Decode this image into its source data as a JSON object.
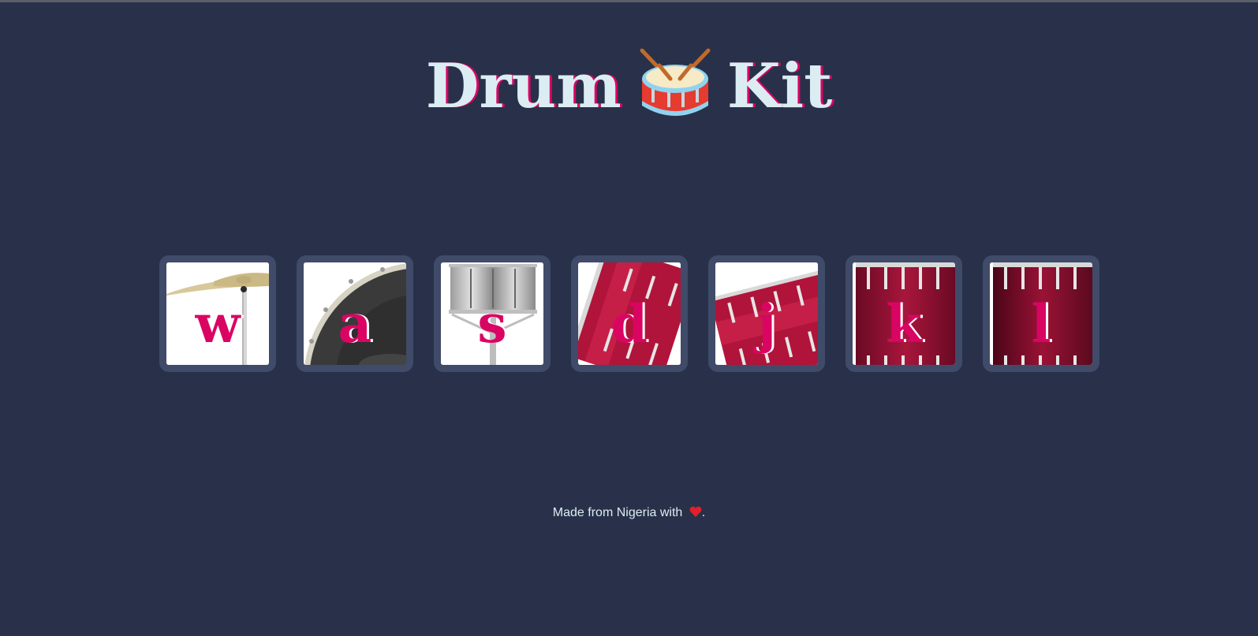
{
  "app": {
    "title_left": "Drum",
    "title_right": "Kit",
    "title_icon": "drum-icon"
  },
  "drums": [
    {
      "key": "w",
      "image": "crash-cymbal"
    },
    {
      "key": "a",
      "image": "kick-drum"
    },
    {
      "key": "s",
      "image": "snare-drum"
    },
    {
      "key": "d",
      "image": "tom-1"
    },
    {
      "key": "j",
      "image": "tom-2"
    },
    {
      "key": "k",
      "image": "tom-3"
    },
    {
      "key": "l",
      "image": "tom-4"
    }
  ],
  "footer": {
    "text_before": "Made from Nigeria with",
    "text_after": ".",
    "icon": "heart-icon"
  },
  "colors": {
    "background": "#283149",
    "drum_frame": "#404b69",
    "key_letter": "#da0463",
    "title_text": "#dbedf3"
  }
}
